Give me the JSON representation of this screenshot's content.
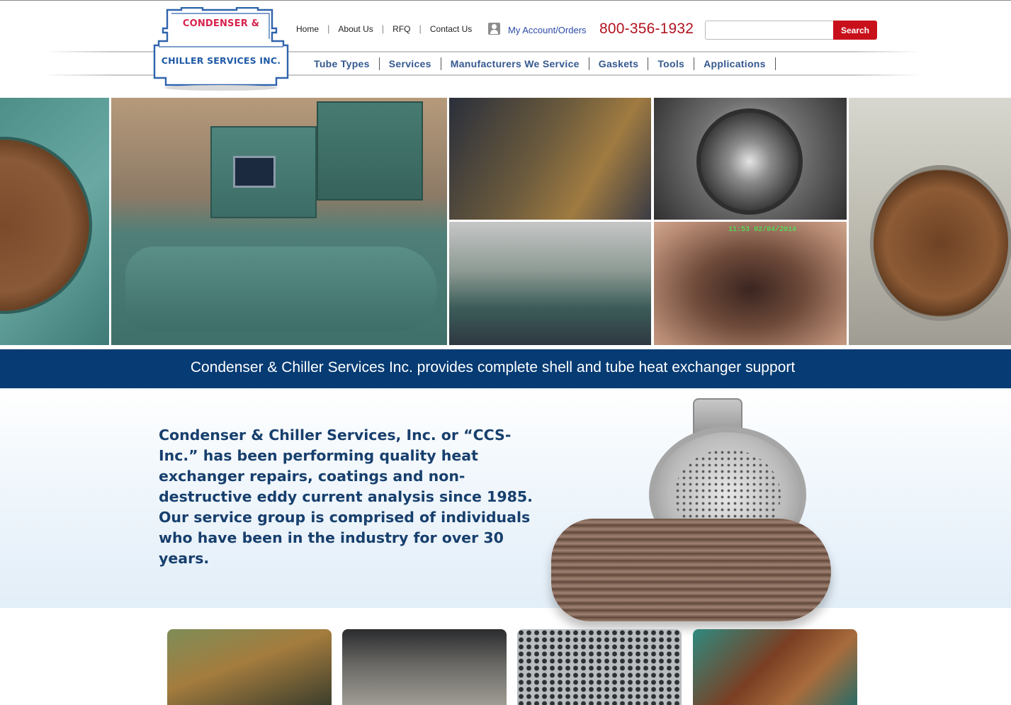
{
  "header": {
    "logo": {
      "line1": "CONDENSER &",
      "line2": "CHILLER SERVICES INC."
    },
    "top_nav": [
      {
        "label": "Home"
      },
      {
        "label": "About Us"
      },
      {
        "label": "RFQ"
      },
      {
        "label": "Contact Us"
      }
    ],
    "account": {
      "label": "My Account/Orders",
      "icon": "user-icon"
    },
    "phone": "800-356-1932",
    "search": {
      "placeholder": "",
      "value": "",
      "button_label": "Search"
    },
    "main_nav": [
      {
        "label": "Tube Types"
      },
      {
        "label": "Services"
      },
      {
        "label": "Manufacturers We Service"
      },
      {
        "label": "Gaskets"
      },
      {
        "label": "Tools"
      },
      {
        "label": "Applications"
      }
    ]
  },
  "mosaic": {
    "inspection_overlay": "11:53 02/04/2014"
  },
  "banner": {
    "text": "Condenser & Chiller Services Inc. provides complete shell and tube heat exchanger support"
  },
  "intro": {
    "text": "Condenser & Chiller Services, Inc. or “CCS-Inc.” has been performing quality heat exchanger repairs, coatings and non-destructive eddy current analysis since 1985. Our service group is comprised of individuals who have been in the industry for over 30 years."
  },
  "colors": {
    "banner_blue": "#063b73",
    "phone_red": "#b0131f",
    "search_red": "#c8101b",
    "nav_blue": "#34588f",
    "intro_text": "#173f6d",
    "logo_red": "#d8234f",
    "logo_blue": "#1f5aa6"
  }
}
